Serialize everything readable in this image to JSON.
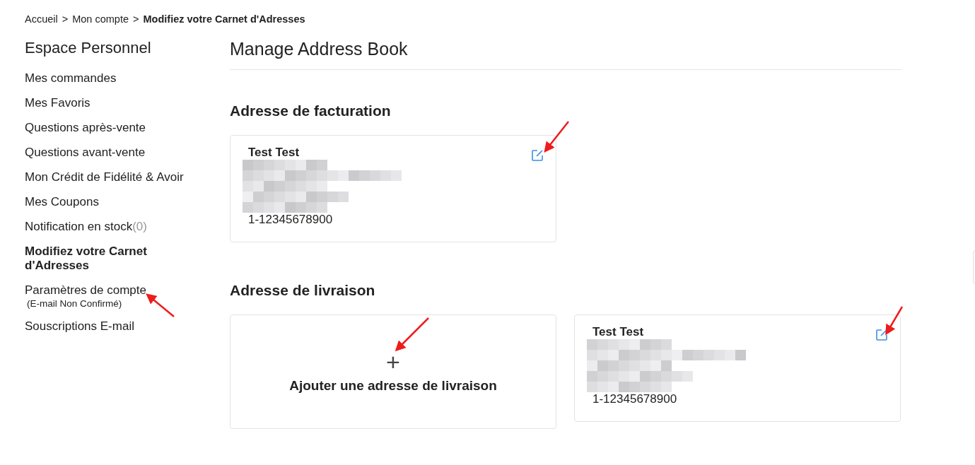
{
  "breadcrumb": [
    {
      "label": "Accueil",
      "current": false
    },
    {
      "label": "Mon compte",
      "current": false
    },
    {
      "label": "Modifiez votre Carnet d'Adresses",
      "current": true
    }
  ],
  "breadcrumb_separator": ">",
  "sidebar": {
    "title": "Espace Personnel",
    "items": [
      {
        "label": "Mes commandes",
        "selected": false
      },
      {
        "label": "Mes Favoris",
        "selected": false
      },
      {
        "label": "Questions après-vente",
        "selected": false
      },
      {
        "label": "Questions avant-vente",
        "selected": false
      },
      {
        "label": "Mon Crédit de Fidélité & Avoir",
        "selected": false
      },
      {
        "label": "Mes Coupons",
        "selected": false
      },
      {
        "label": "Notification en stock",
        "count": "(0)",
        "selected": false
      },
      {
        "label": "Modifiez votre Carnet d'Adresses",
        "selected": true
      },
      {
        "label": "Paramètres de compte",
        "note": "(E-mail Non Confirmé)",
        "selected": false
      },
      {
        "label": "Souscriptions E-mail",
        "selected": false
      }
    ]
  },
  "main": {
    "title": "Manage Address Book",
    "sections": [
      {
        "heading": "Adresse de facturation",
        "cards": [
          {
            "kind": "address",
            "name": "Test Test",
            "phone": "1-12345678900"
          }
        ]
      },
      {
        "heading": "Adresse de livraison",
        "cards": [
          {
            "kind": "add",
            "icon": "+",
            "label": "Ajouter une adresse de livraison"
          },
          {
            "kind": "address",
            "name": "Test Test",
            "phone": "1-12345678900"
          }
        ]
      }
    ]
  }
}
